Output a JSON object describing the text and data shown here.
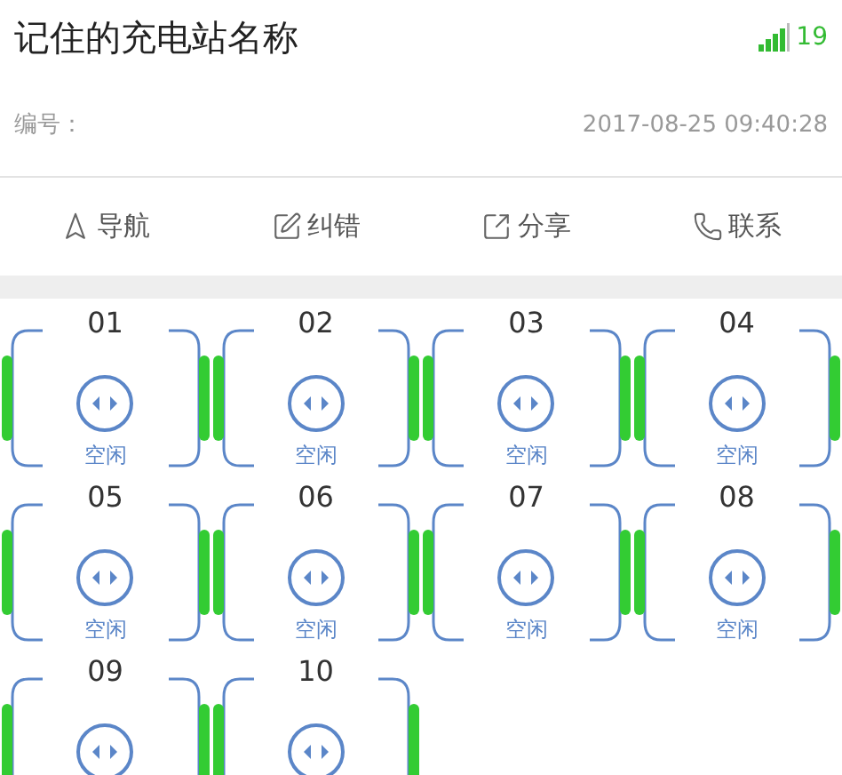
{
  "header": {
    "title": "记住的充电站名称",
    "signal_count": "19"
  },
  "info": {
    "number_label": "编号：",
    "timestamp": "2017-08-25 09:40:28"
  },
  "actions": [
    {
      "kind": "navigate",
      "label": "导航"
    },
    {
      "kind": "report",
      "label": "纠错"
    },
    {
      "kind": "share",
      "label": "分享"
    },
    {
      "kind": "contact",
      "label": "联系"
    }
  ],
  "stalls": [
    {
      "number": "01",
      "status": "空闲"
    },
    {
      "number": "02",
      "status": "空闲"
    },
    {
      "number": "03",
      "status": "空闲"
    },
    {
      "number": "04",
      "status": "空闲"
    },
    {
      "number": "05",
      "status": "空闲"
    },
    {
      "number": "06",
      "status": "空闲"
    },
    {
      "number": "07",
      "status": "空闲"
    },
    {
      "number": "08",
      "status": "空闲"
    },
    {
      "number": "09"
    },
    {
      "number": "10"
    }
  ]
}
